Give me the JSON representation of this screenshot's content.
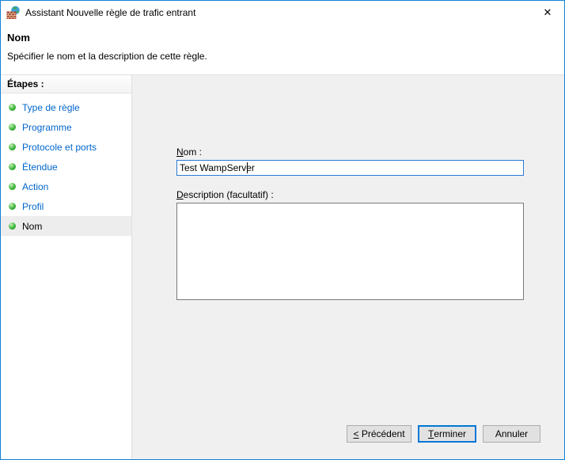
{
  "titlebar": {
    "title": "Assistant Nouvelle règle de trafic entrant",
    "close_glyph": "✕"
  },
  "header": {
    "title": "Nom",
    "subtitle": "Spécifier le nom et la description de cette règle."
  },
  "sidebar": {
    "heading": "Étapes :",
    "items": [
      {
        "label": "Type de règle",
        "state": "completed"
      },
      {
        "label": "Programme",
        "state": "completed"
      },
      {
        "label": "Protocole et ports",
        "state": "completed"
      },
      {
        "label": "Étendue",
        "state": "completed"
      },
      {
        "label": "Action",
        "state": "completed"
      },
      {
        "label": "Profil",
        "state": "completed"
      },
      {
        "label": "Nom",
        "state": "current"
      }
    ]
  },
  "form": {
    "name_label": {
      "mnemonic": "N",
      "rest": "om :"
    },
    "name_value": "Test WampServer",
    "description_label": {
      "mnemonic": "D",
      "rest": "escription (facultatif) :"
    },
    "description_value": ""
  },
  "buttons": {
    "back": {
      "mnemonic": "<",
      "rest": " Précédent"
    },
    "finish": {
      "mnemonic": "T",
      "rest": "erminer"
    },
    "cancel": {
      "mnemonic": "",
      "rest": "Annuler"
    }
  },
  "colors": {
    "window_border": "#1582d7",
    "accent": "#0078d7",
    "step_link": "#0066cc",
    "step_bullet_green": "#3db53c",
    "active_step_bg": "#ededed",
    "content_bg": "#f0f0f0",
    "button_bg": "#e1e1e1",
    "button_border": "#adadad"
  }
}
